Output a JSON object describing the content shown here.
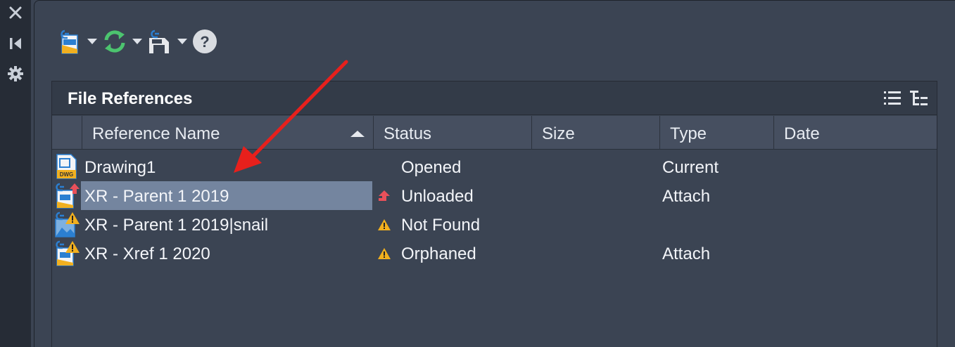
{
  "left_strip": {
    "icons": [
      "close-icon",
      "dock-icon",
      "gear-icon"
    ]
  },
  "toolbar": {
    "buttons": [
      {
        "icon": "attach-reference-icon",
        "has_dropdown": true
      },
      {
        "icon": "refresh-icon",
        "has_dropdown": true
      },
      {
        "icon": "change-path-icon",
        "has_dropdown": true
      },
      {
        "icon": "help-icon",
        "has_dropdown": false,
        "glyph": "?"
      }
    ]
  },
  "panel": {
    "title": "File References",
    "view_buttons": [
      "list-view-icon",
      "tree-view-icon"
    ],
    "columns": [
      {
        "label": "Reference Name",
        "sorted": "ascending"
      },
      {
        "label": "Status"
      },
      {
        "label": "Size"
      },
      {
        "label": "Type"
      },
      {
        "label": "Date"
      }
    ],
    "rows": [
      {
        "icon": "dwg-file-icon",
        "name": "Drawing1",
        "status_icon": "",
        "status": "Opened",
        "size": "",
        "type": "Current",
        "date": "",
        "selected": false
      },
      {
        "icon": "xref-unloaded-icon",
        "name": "XR - Parent 1 2019",
        "status_icon": "unloaded-arrow-icon",
        "status": "Unloaded",
        "size": "",
        "type": "Attach",
        "date": "",
        "selected": true
      },
      {
        "icon": "image-warning-icon",
        "name": "XR - Parent 1 2019|snail",
        "status_icon": "warning-icon",
        "status": "Not Found",
        "size": "",
        "type": "",
        "date": "",
        "selected": false
      },
      {
        "icon": "xref-warning-icon",
        "name": "XR - Xref 1 2020",
        "status_icon": "warning-icon",
        "status": "Orphaned",
        "size": "",
        "type": "Attach",
        "date": "",
        "selected": false
      }
    ]
  },
  "colors": {
    "strip_bg": "#262c36",
    "panel_bg": "#3b4453",
    "header_bg": "#464f60",
    "selection": "#74859f",
    "annotation_arrow": "#e8201c",
    "warning": "#f2b01e",
    "unloaded": "#e9505a"
  }
}
